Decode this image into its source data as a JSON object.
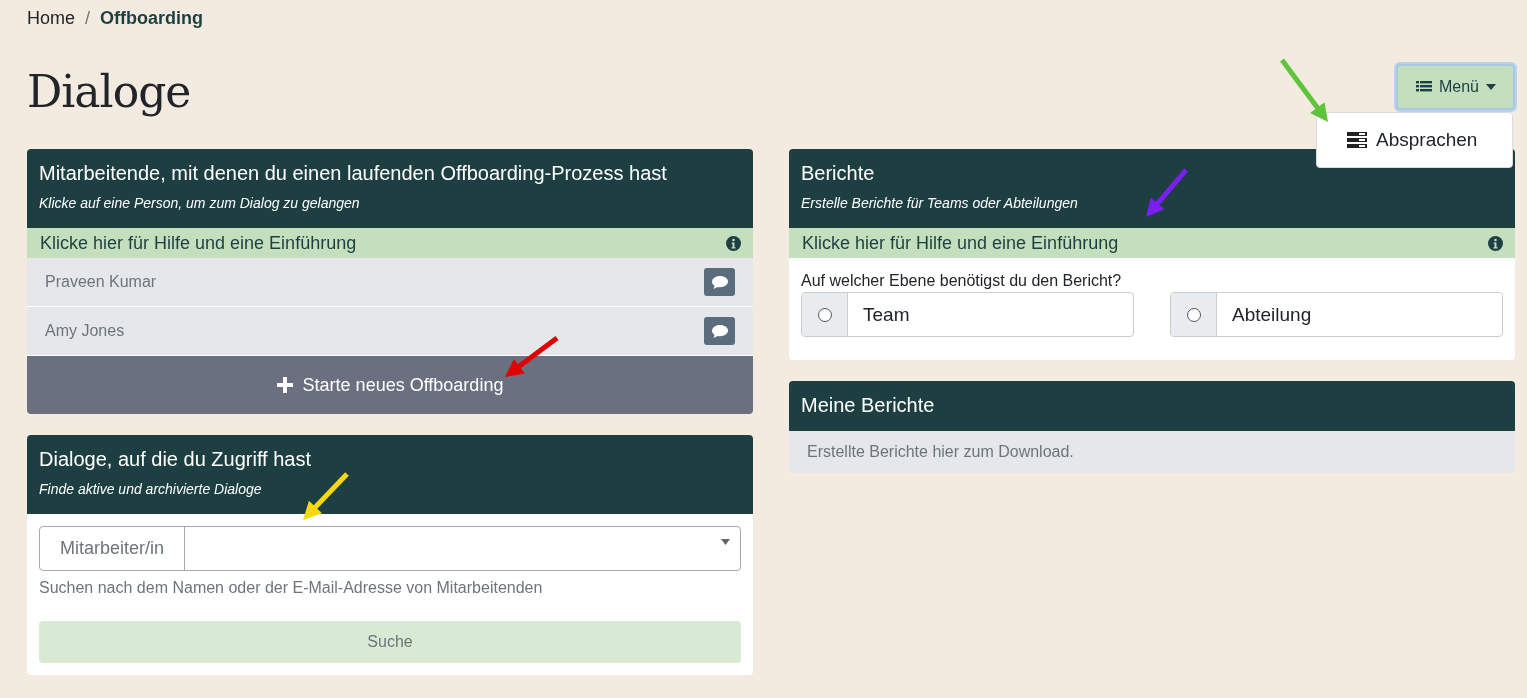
{
  "breadcrumb_separator": "/",
  "breadcrumb": [
    {
      "label": "Home",
      "current": false
    },
    {
      "label": "Offboarding",
      "current": true
    }
  ],
  "title": "Dialoge",
  "menu": {
    "label": "Menü",
    "expanded": true,
    "items": [
      {
        "label": "Absprachen"
      }
    ]
  },
  "running_offboardings": {
    "title": "Mitarbeitende, mit denen du einen laufenden Offboarding-Prozess hast",
    "subtitle": "Klicke auf eine Person, um zum Dialog zu gelangen",
    "help": "Klicke hier für Hilfe und eine Einführung",
    "people": [
      {
        "name": "Praveen Kumar"
      },
      {
        "name": "Amy Jones"
      }
    ],
    "start_button": "Starte neues Offboarding"
  },
  "accessible_dialogs": {
    "title": "Dialoge, auf die du Zugriff hast",
    "subtitle": "Finde aktive und archivierte Dialoge",
    "field_label": "Mitarbeiter/in",
    "hint": "Suchen nach dem Namen oder der E-Mail-Adresse von Mitarbeitenden",
    "search_button": {
      "label": "Suche",
      "disabled": true
    }
  },
  "reports": {
    "title": "Berichte",
    "subtitle": "Erstelle Berichte für Teams oder Abteilungen",
    "help": "Klicke hier für Hilfe und eine Einführung",
    "question": "Auf welcher Ebene benötigst du den Bericht?",
    "options": [
      {
        "label": "Team",
        "selected": false
      },
      {
        "label": "Abteilung",
        "selected": false
      }
    ]
  },
  "my_reports": {
    "title": "Meine Berichte",
    "empty_text": "Erstellte Berichte hier zum Download."
  },
  "annotations": [
    {
      "color": "#e00000"
    },
    {
      "color": "#5fc33b"
    },
    {
      "color": "#7a1ff0"
    },
    {
      "color": "#f5d90f"
    }
  ]
}
